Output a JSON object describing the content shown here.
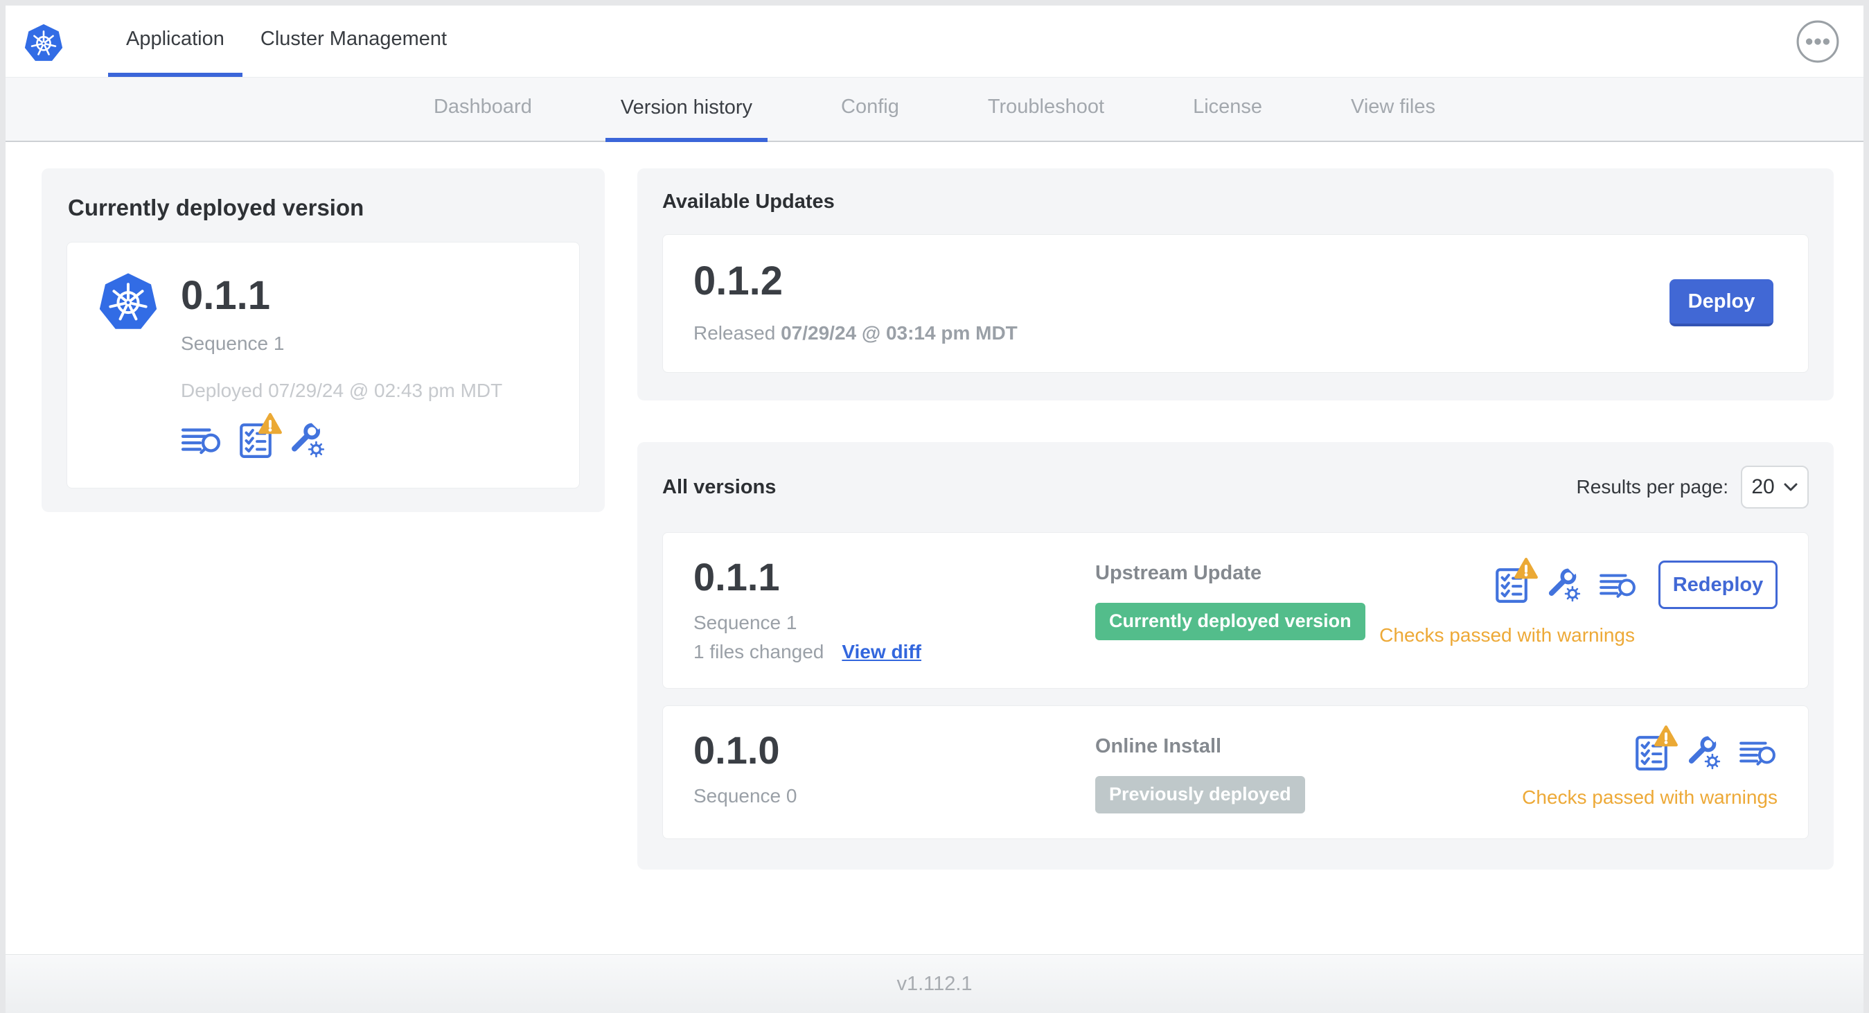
{
  "header": {
    "tabs": [
      {
        "label": "Application",
        "active": true
      },
      {
        "label": "Cluster Management",
        "active": false
      }
    ]
  },
  "nav": {
    "items": [
      {
        "label": "Dashboard",
        "active": false
      },
      {
        "label": "Version history",
        "active": true
      },
      {
        "label": "Config",
        "active": false
      },
      {
        "label": "Troubleshoot",
        "active": false
      },
      {
        "label": "License",
        "active": false
      },
      {
        "label": "View files",
        "active": false
      }
    ]
  },
  "deployed": {
    "title": "Currently deployed version",
    "version": "0.1.1",
    "sequence": "Sequence 1",
    "deployed_at": "Deployed 07/29/24 @ 02:43 pm MDT"
  },
  "available_updates": {
    "title": "Available Updates",
    "version": "0.1.2",
    "released_prefix": "Released",
    "released_date": "07/29/24 @ 03:14 pm MDT",
    "deploy_label": "Deploy"
  },
  "all_versions": {
    "title": "All versions",
    "results_per_page_label": "Results per page:",
    "results_per_page_value": "20",
    "rows": [
      {
        "version": "0.1.1",
        "sequence": "Sequence 1",
        "files_changed": "1 files changed",
        "diff_link": "View diff",
        "source": "Upstream Update",
        "badge": "Currently deployed version",
        "status": "Checks passed with warnings",
        "action": "Redeploy"
      },
      {
        "version": "0.1.0",
        "sequence": "Sequence 0",
        "source": "Online Install",
        "badge": "Previously deployed",
        "status": "Checks passed with warnings"
      }
    ]
  },
  "footer": {
    "version": "v1.112.1"
  },
  "icons": {
    "deployed_card": [
      "release-notes-icon",
      "preflight-checks-warning-icon",
      "edit-config-icon"
    ],
    "version_rows": [
      "preflight-checks-warning-icon",
      "edit-config-icon",
      "release-notes-icon"
    ]
  },
  "colors": {
    "accent_blue": "#3b66d9",
    "button_blue": "#4168d5",
    "icon_blue": "#4273dd",
    "link_blue": "#3266dd",
    "badge_green": "#53bd8b",
    "badge_gray": "#bfc8ca",
    "warning_orange": "#eda937",
    "kubernetes_blue": "#326ce5",
    "panel_gray": "#f4f5f7"
  }
}
